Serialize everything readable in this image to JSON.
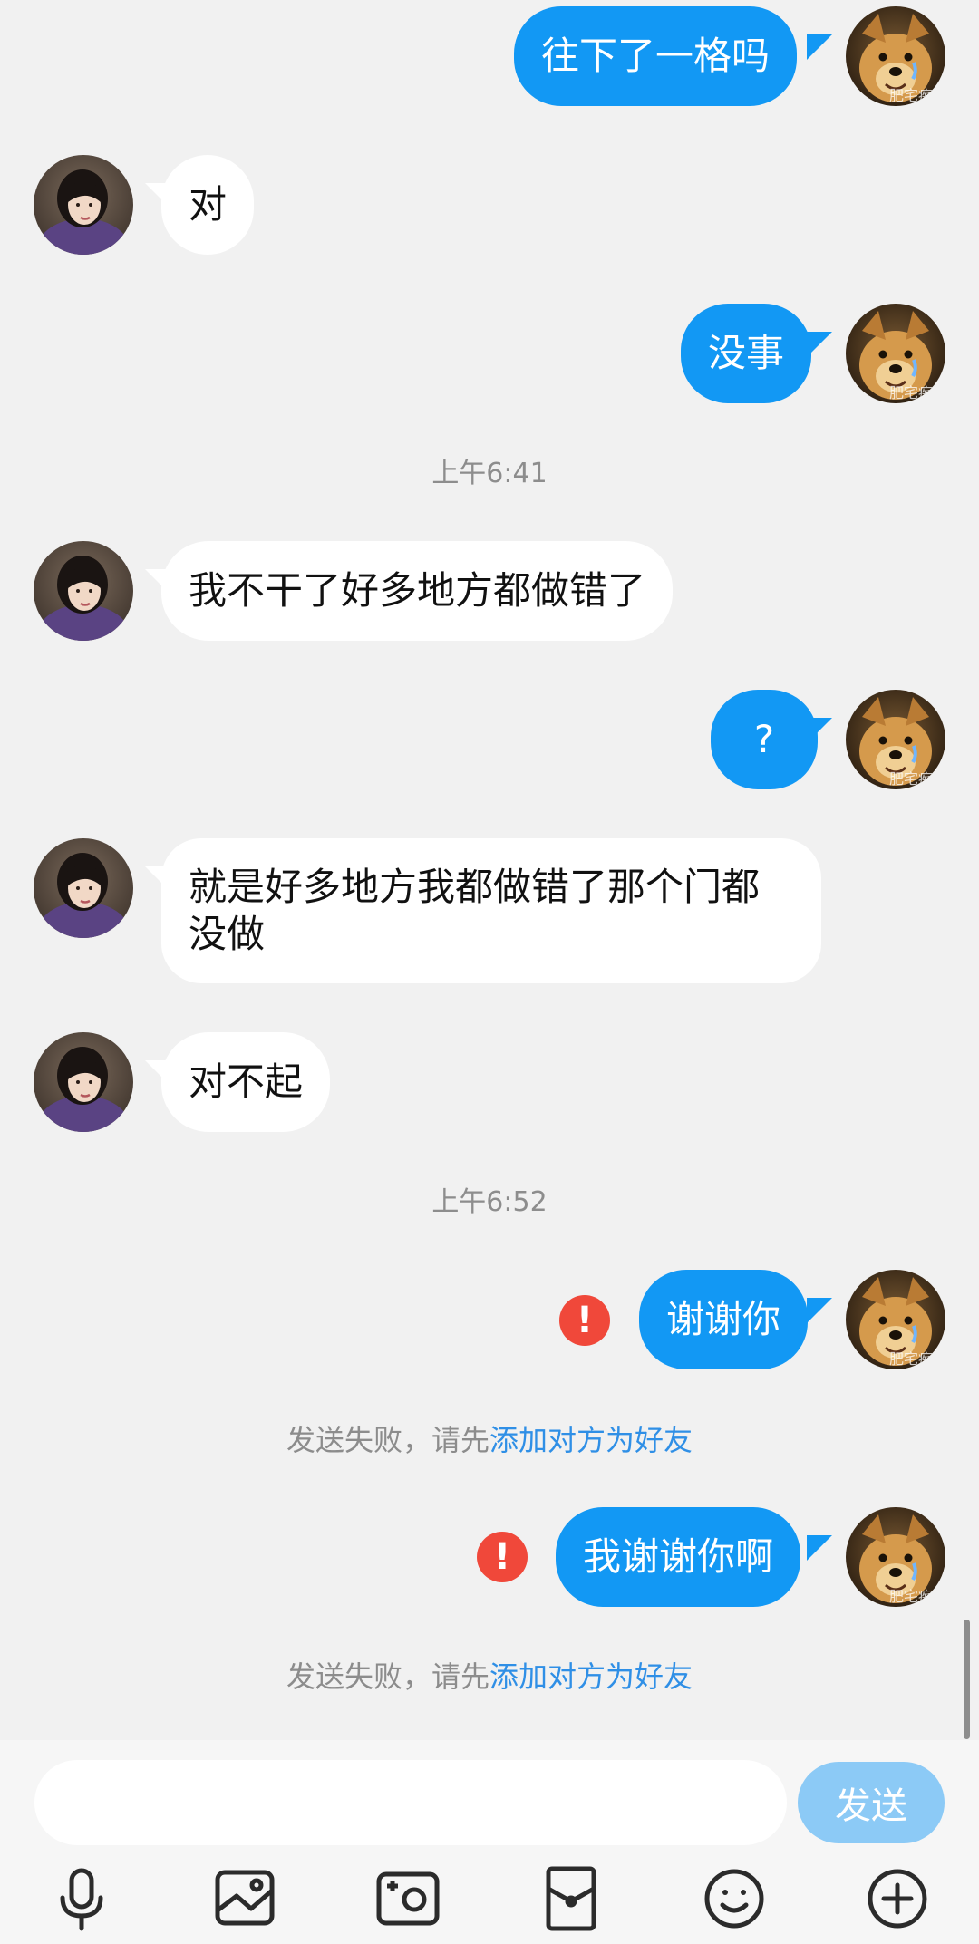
{
  "messages": [
    {
      "side": "out",
      "text": "往下了一格吗"
    },
    {
      "side": "in",
      "text": "对"
    },
    {
      "side": "out",
      "text": "没事"
    },
    {
      "time": "上午6:41"
    },
    {
      "side": "in",
      "text": "我不干了好多地方都做错了"
    },
    {
      "side": "out",
      "text": "?"
    },
    {
      "side": "in",
      "text": "就是好多地方我都做错了那个门都没做"
    },
    {
      "side": "in",
      "text": "对不起"
    },
    {
      "time": "上午6:52"
    },
    {
      "side": "out",
      "text": "谢谢你",
      "failed": true
    },
    {
      "notice_prefix": "发送失败，请先",
      "notice_link": "添加对方为好友"
    },
    {
      "side": "out",
      "text": "我谢谢你啊",
      "failed": true
    },
    {
      "notice_prefix": "发送失败，请先",
      "notice_link": "添加对方为好友"
    }
  ],
  "avatar_watermark": "肥宅痴笑",
  "fail_icon_glyph": "!",
  "composer": {
    "input_value": "",
    "send_label": "发送"
  },
  "toolbar_icons": [
    "microphone-icon",
    "image-icon",
    "camera-icon",
    "red-packet-icon",
    "emoji-icon",
    "plus-icon"
  ],
  "colors": {
    "background": "#f1f1f1",
    "outgoing_bubble": "#1298f4",
    "incoming_bubble": "#ffffff",
    "fail_icon": "#f0483a",
    "link": "#2f8fe6",
    "send_button": "#8ccaf6"
  }
}
